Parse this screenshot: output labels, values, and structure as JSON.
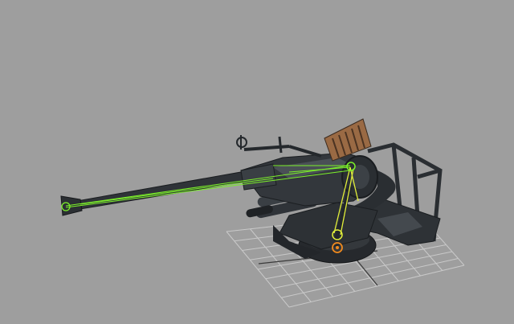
{
  "viewport": {
    "background": "#9e9e9e",
    "grid_color": "#c8c8c8",
    "model_body": "#2b2f33",
    "model_dark": "#1b1e21",
    "model_mid": "#3c4146",
    "rig_green": "#7cf02a",
    "rig_yellow": "#e2ef3a",
    "rig_orange": "#f08a1e",
    "magazine_color": "#9a6a44"
  },
  "scene": {
    "objects": [
      {
        "name": "anti-aircraft-gun-model",
        "selected": true
      },
      {
        "name": "ground-grid",
        "selected": false
      }
    ],
    "icons": [
      "rig-joint-icon",
      "rig-root-icon",
      "rig-muzzle-icon"
    ]
  }
}
